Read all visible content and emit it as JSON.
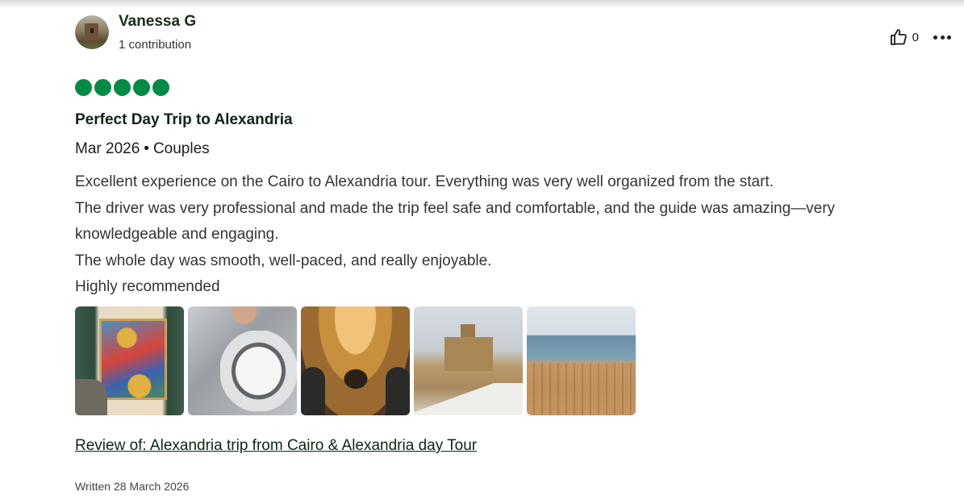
{
  "reviewer": {
    "name": "Vanessa G",
    "contributions": "1 contribution"
  },
  "actions": {
    "helpful_count": "0",
    "icons": [
      "thumbs-up-icon",
      "more-options-icon"
    ]
  },
  "rating": {
    "value": 5,
    "max": 5,
    "color": "#008a46"
  },
  "review": {
    "title": "Perfect Day Trip to Alexandria",
    "date": "Mar 2026",
    "separator": "•",
    "trip_type": "Couples",
    "body_lines": [
      "Excellent experience on the Cairo to Alexandria tour. Everything was very well organized from the start.",
      "The driver was very professional and made the trip feel safe and comfortable, and the guide was amazing—very",
      "knowledgeable and engaging.",
      "The whole day was smooth, well-paced, and really enjoyable.",
      "Highly recommended"
    ],
    "review_of": "Review of: Alexandria trip from Cairo & Alexandria day Tour",
    "written": "Written 28 March 2026"
  },
  "photos": {
    "count": 5
  }
}
